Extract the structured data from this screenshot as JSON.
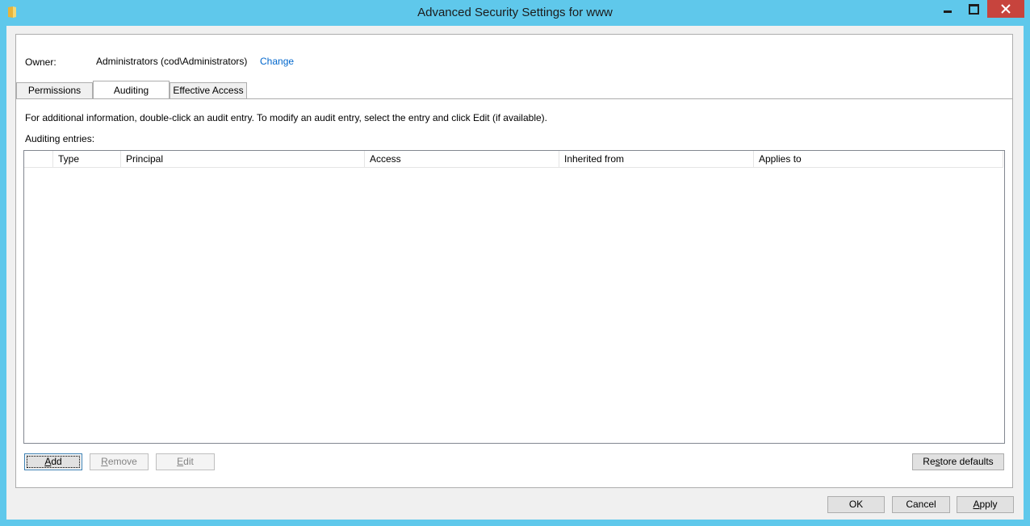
{
  "window": {
    "title": "Advanced Security Settings for www",
    "icon": "folder-icon"
  },
  "owner": {
    "label": "Owner:",
    "value": "Administrators (cod\\Administrators)",
    "change_link": "Change"
  },
  "tabs": [
    {
      "label": "Permissions",
      "active": false
    },
    {
      "label": "Auditing",
      "active": true
    },
    {
      "label": "Effective Access",
      "active": false
    }
  ],
  "info_text": "For additional information, double-click an audit entry. To modify an audit entry, select the entry and click Edit (if available).",
  "entries_label": "Auditing entries:",
  "columns": [
    "Type",
    "Principal",
    "Access",
    "Inherited from",
    "Applies to"
  ],
  "rows": [],
  "buttons": {
    "add": {
      "label": "Add",
      "mnemonic": "A"
    },
    "remove": {
      "label": "Remove",
      "mnemonic": "R"
    },
    "edit": {
      "label": "Edit",
      "mnemonic": "E"
    },
    "restore": {
      "label": "Restore defaults",
      "mnemonic": "s"
    },
    "ok": "OK",
    "cancel": "Cancel",
    "apply": {
      "label": "Apply",
      "mnemonic": "A"
    }
  },
  "colors": {
    "frame": "#5fc8eb",
    "close": "#c7443d",
    "link": "#0066cc"
  }
}
